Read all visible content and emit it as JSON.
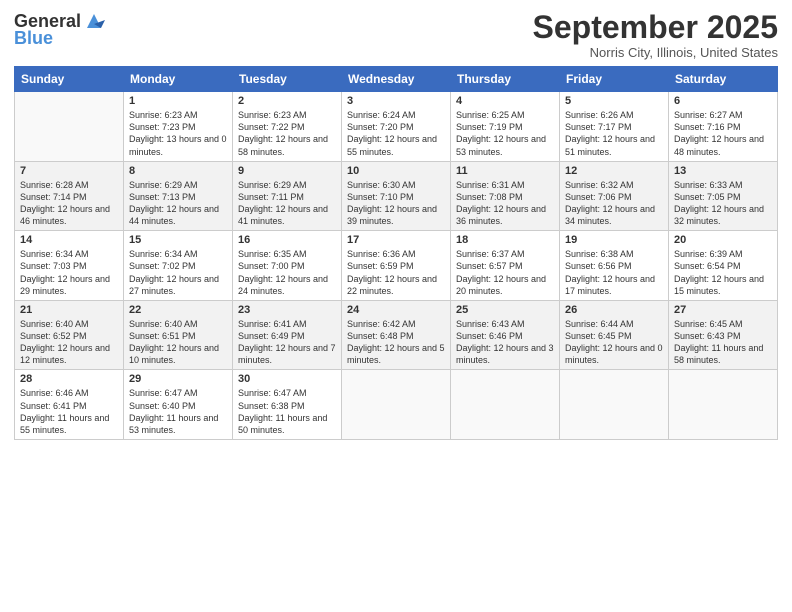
{
  "header": {
    "logo_general": "General",
    "logo_blue": "Blue",
    "month_title": "September 2025",
    "location": "Norris City, Illinois, United States"
  },
  "weekdays": [
    "Sunday",
    "Monday",
    "Tuesday",
    "Wednesday",
    "Thursday",
    "Friday",
    "Saturday"
  ],
  "weeks": [
    [
      {
        "day": "",
        "info": ""
      },
      {
        "day": "1",
        "info": "Sunrise: 6:23 AM\nSunset: 7:23 PM\nDaylight: 13 hours\nand 0 minutes."
      },
      {
        "day": "2",
        "info": "Sunrise: 6:23 AM\nSunset: 7:22 PM\nDaylight: 12 hours\nand 58 minutes."
      },
      {
        "day": "3",
        "info": "Sunrise: 6:24 AM\nSunset: 7:20 PM\nDaylight: 12 hours\nand 55 minutes."
      },
      {
        "day": "4",
        "info": "Sunrise: 6:25 AM\nSunset: 7:19 PM\nDaylight: 12 hours\nand 53 minutes."
      },
      {
        "day": "5",
        "info": "Sunrise: 6:26 AM\nSunset: 7:17 PM\nDaylight: 12 hours\nand 51 minutes."
      },
      {
        "day": "6",
        "info": "Sunrise: 6:27 AM\nSunset: 7:16 PM\nDaylight: 12 hours\nand 48 minutes."
      }
    ],
    [
      {
        "day": "7",
        "info": "Sunrise: 6:28 AM\nSunset: 7:14 PM\nDaylight: 12 hours\nand 46 minutes."
      },
      {
        "day": "8",
        "info": "Sunrise: 6:29 AM\nSunset: 7:13 PM\nDaylight: 12 hours\nand 44 minutes."
      },
      {
        "day": "9",
        "info": "Sunrise: 6:29 AM\nSunset: 7:11 PM\nDaylight: 12 hours\nand 41 minutes."
      },
      {
        "day": "10",
        "info": "Sunrise: 6:30 AM\nSunset: 7:10 PM\nDaylight: 12 hours\nand 39 minutes."
      },
      {
        "day": "11",
        "info": "Sunrise: 6:31 AM\nSunset: 7:08 PM\nDaylight: 12 hours\nand 36 minutes."
      },
      {
        "day": "12",
        "info": "Sunrise: 6:32 AM\nSunset: 7:06 PM\nDaylight: 12 hours\nand 34 minutes."
      },
      {
        "day": "13",
        "info": "Sunrise: 6:33 AM\nSunset: 7:05 PM\nDaylight: 12 hours\nand 32 minutes."
      }
    ],
    [
      {
        "day": "14",
        "info": "Sunrise: 6:34 AM\nSunset: 7:03 PM\nDaylight: 12 hours\nand 29 minutes."
      },
      {
        "day": "15",
        "info": "Sunrise: 6:34 AM\nSunset: 7:02 PM\nDaylight: 12 hours\nand 27 minutes."
      },
      {
        "day": "16",
        "info": "Sunrise: 6:35 AM\nSunset: 7:00 PM\nDaylight: 12 hours\nand 24 minutes."
      },
      {
        "day": "17",
        "info": "Sunrise: 6:36 AM\nSunset: 6:59 PM\nDaylight: 12 hours\nand 22 minutes."
      },
      {
        "day": "18",
        "info": "Sunrise: 6:37 AM\nSunset: 6:57 PM\nDaylight: 12 hours\nand 20 minutes."
      },
      {
        "day": "19",
        "info": "Sunrise: 6:38 AM\nSunset: 6:56 PM\nDaylight: 12 hours\nand 17 minutes."
      },
      {
        "day": "20",
        "info": "Sunrise: 6:39 AM\nSunset: 6:54 PM\nDaylight: 12 hours\nand 15 minutes."
      }
    ],
    [
      {
        "day": "21",
        "info": "Sunrise: 6:40 AM\nSunset: 6:52 PM\nDaylight: 12 hours\nand 12 minutes."
      },
      {
        "day": "22",
        "info": "Sunrise: 6:40 AM\nSunset: 6:51 PM\nDaylight: 12 hours\nand 10 minutes."
      },
      {
        "day": "23",
        "info": "Sunrise: 6:41 AM\nSunset: 6:49 PM\nDaylight: 12 hours\nand 7 minutes."
      },
      {
        "day": "24",
        "info": "Sunrise: 6:42 AM\nSunset: 6:48 PM\nDaylight: 12 hours\nand 5 minutes."
      },
      {
        "day": "25",
        "info": "Sunrise: 6:43 AM\nSunset: 6:46 PM\nDaylight: 12 hours\nand 3 minutes."
      },
      {
        "day": "26",
        "info": "Sunrise: 6:44 AM\nSunset: 6:45 PM\nDaylight: 12 hours\nand 0 minutes."
      },
      {
        "day": "27",
        "info": "Sunrise: 6:45 AM\nSunset: 6:43 PM\nDaylight: 11 hours\nand 58 minutes."
      }
    ],
    [
      {
        "day": "28",
        "info": "Sunrise: 6:46 AM\nSunset: 6:41 PM\nDaylight: 11 hours\nand 55 minutes."
      },
      {
        "day": "29",
        "info": "Sunrise: 6:47 AM\nSunset: 6:40 PM\nDaylight: 11 hours\nand 53 minutes."
      },
      {
        "day": "30",
        "info": "Sunrise: 6:47 AM\nSunset: 6:38 PM\nDaylight: 11 hours\nand 50 minutes."
      },
      {
        "day": "",
        "info": ""
      },
      {
        "day": "",
        "info": ""
      },
      {
        "day": "",
        "info": ""
      },
      {
        "day": "",
        "info": ""
      }
    ]
  ]
}
